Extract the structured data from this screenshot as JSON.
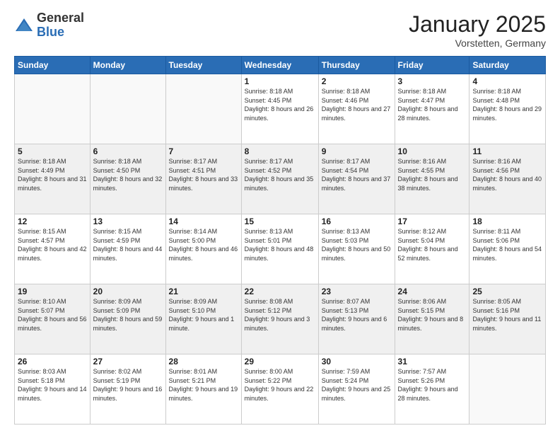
{
  "header": {
    "logo_general": "General",
    "logo_blue": "Blue",
    "month_title": "January 2025",
    "location": "Vorstetten, Germany"
  },
  "weekdays": [
    "Sunday",
    "Monday",
    "Tuesday",
    "Wednesday",
    "Thursday",
    "Friday",
    "Saturday"
  ],
  "weeks": [
    [
      {
        "day": "",
        "sunrise": "",
        "sunset": "",
        "daylight": ""
      },
      {
        "day": "",
        "sunrise": "",
        "sunset": "",
        "daylight": ""
      },
      {
        "day": "",
        "sunrise": "",
        "sunset": "",
        "daylight": ""
      },
      {
        "day": "1",
        "sunrise": "Sunrise: 8:18 AM",
        "sunset": "Sunset: 4:45 PM",
        "daylight": "Daylight: 8 hours and 26 minutes."
      },
      {
        "day": "2",
        "sunrise": "Sunrise: 8:18 AM",
        "sunset": "Sunset: 4:46 PM",
        "daylight": "Daylight: 8 hours and 27 minutes."
      },
      {
        "day": "3",
        "sunrise": "Sunrise: 8:18 AM",
        "sunset": "Sunset: 4:47 PM",
        "daylight": "Daylight: 8 hours and 28 minutes."
      },
      {
        "day": "4",
        "sunrise": "Sunrise: 8:18 AM",
        "sunset": "Sunset: 4:48 PM",
        "daylight": "Daylight: 8 hours and 29 minutes."
      }
    ],
    [
      {
        "day": "5",
        "sunrise": "Sunrise: 8:18 AM",
        "sunset": "Sunset: 4:49 PM",
        "daylight": "Daylight: 8 hours and 31 minutes."
      },
      {
        "day": "6",
        "sunrise": "Sunrise: 8:18 AM",
        "sunset": "Sunset: 4:50 PM",
        "daylight": "Daylight: 8 hours and 32 minutes."
      },
      {
        "day": "7",
        "sunrise": "Sunrise: 8:17 AM",
        "sunset": "Sunset: 4:51 PM",
        "daylight": "Daylight: 8 hours and 33 minutes."
      },
      {
        "day": "8",
        "sunrise": "Sunrise: 8:17 AM",
        "sunset": "Sunset: 4:52 PM",
        "daylight": "Daylight: 8 hours and 35 minutes."
      },
      {
        "day": "9",
        "sunrise": "Sunrise: 8:17 AM",
        "sunset": "Sunset: 4:54 PM",
        "daylight": "Daylight: 8 hours and 37 minutes."
      },
      {
        "day": "10",
        "sunrise": "Sunrise: 8:16 AM",
        "sunset": "Sunset: 4:55 PM",
        "daylight": "Daylight: 8 hours and 38 minutes."
      },
      {
        "day": "11",
        "sunrise": "Sunrise: 8:16 AM",
        "sunset": "Sunset: 4:56 PM",
        "daylight": "Daylight: 8 hours and 40 minutes."
      }
    ],
    [
      {
        "day": "12",
        "sunrise": "Sunrise: 8:15 AM",
        "sunset": "Sunset: 4:57 PM",
        "daylight": "Daylight: 8 hours and 42 minutes."
      },
      {
        "day": "13",
        "sunrise": "Sunrise: 8:15 AM",
        "sunset": "Sunset: 4:59 PM",
        "daylight": "Daylight: 8 hours and 44 minutes."
      },
      {
        "day": "14",
        "sunrise": "Sunrise: 8:14 AM",
        "sunset": "Sunset: 5:00 PM",
        "daylight": "Daylight: 8 hours and 46 minutes."
      },
      {
        "day": "15",
        "sunrise": "Sunrise: 8:13 AM",
        "sunset": "Sunset: 5:01 PM",
        "daylight": "Daylight: 8 hours and 48 minutes."
      },
      {
        "day": "16",
        "sunrise": "Sunrise: 8:13 AM",
        "sunset": "Sunset: 5:03 PM",
        "daylight": "Daylight: 8 hours and 50 minutes."
      },
      {
        "day": "17",
        "sunrise": "Sunrise: 8:12 AM",
        "sunset": "Sunset: 5:04 PM",
        "daylight": "Daylight: 8 hours and 52 minutes."
      },
      {
        "day": "18",
        "sunrise": "Sunrise: 8:11 AM",
        "sunset": "Sunset: 5:06 PM",
        "daylight": "Daylight: 8 hours and 54 minutes."
      }
    ],
    [
      {
        "day": "19",
        "sunrise": "Sunrise: 8:10 AM",
        "sunset": "Sunset: 5:07 PM",
        "daylight": "Daylight: 8 hours and 56 minutes."
      },
      {
        "day": "20",
        "sunrise": "Sunrise: 8:09 AM",
        "sunset": "Sunset: 5:09 PM",
        "daylight": "Daylight: 8 hours and 59 minutes."
      },
      {
        "day": "21",
        "sunrise": "Sunrise: 8:09 AM",
        "sunset": "Sunset: 5:10 PM",
        "daylight": "Daylight: 9 hours and 1 minute."
      },
      {
        "day": "22",
        "sunrise": "Sunrise: 8:08 AM",
        "sunset": "Sunset: 5:12 PM",
        "daylight": "Daylight: 9 hours and 3 minutes."
      },
      {
        "day": "23",
        "sunrise": "Sunrise: 8:07 AM",
        "sunset": "Sunset: 5:13 PM",
        "daylight": "Daylight: 9 hours and 6 minutes."
      },
      {
        "day": "24",
        "sunrise": "Sunrise: 8:06 AM",
        "sunset": "Sunset: 5:15 PM",
        "daylight": "Daylight: 9 hours and 8 minutes."
      },
      {
        "day": "25",
        "sunrise": "Sunrise: 8:05 AM",
        "sunset": "Sunset: 5:16 PM",
        "daylight": "Daylight: 9 hours and 11 minutes."
      }
    ],
    [
      {
        "day": "26",
        "sunrise": "Sunrise: 8:03 AM",
        "sunset": "Sunset: 5:18 PM",
        "daylight": "Daylight: 9 hours and 14 minutes."
      },
      {
        "day": "27",
        "sunrise": "Sunrise: 8:02 AM",
        "sunset": "Sunset: 5:19 PM",
        "daylight": "Daylight: 9 hours and 16 minutes."
      },
      {
        "day": "28",
        "sunrise": "Sunrise: 8:01 AM",
        "sunset": "Sunset: 5:21 PM",
        "daylight": "Daylight: 9 hours and 19 minutes."
      },
      {
        "day": "29",
        "sunrise": "Sunrise: 8:00 AM",
        "sunset": "Sunset: 5:22 PM",
        "daylight": "Daylight: 9 hours and 22 minutes."
      },
      {
        "day": "30",
        "sunrise": "Sunrise: 7:59 AM",
        "sunset": "Sunset: 5:24 PM",
        "daylight": "Daylight: 9 hours and 25 minutes."
      },
      {
        "day": "31",
        "sunrise": "Sunrise: 7:57 AM",
        "sunset": "Sunset: 5:26 PM",
        "daylight": "Daylight: 9 hours and 28 minutes."
      },
      {
        "day": "",
        "sunrise": "",
        "sunset": "",
        "daylight": ""
      }
    ]
  ]
}
